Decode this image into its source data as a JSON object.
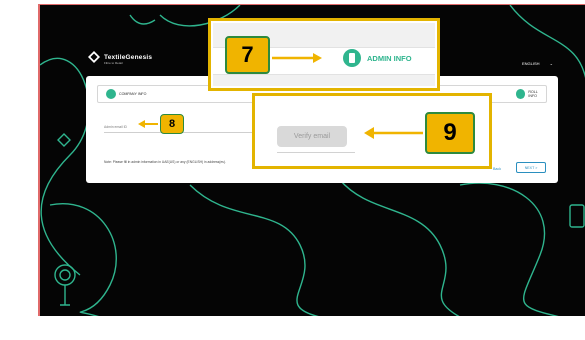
{
  "brand": {
    "name": "TextileGenesis",
    "tagline": "Fibre to Retail"
  },
  "header": {
    "language": "ENGLISH",
    "chevron": "⌄"
  },
  "stepper": {
    "company_info": "COMPANY INFO",
    "roll_info": "ROLL INFO",
    "admin_info": "ADMIN INFO"
  },
  "form": {
    "admin_email_placeholder": "Admin email ID",
    "verify_email_label": "Verify email",
    "note": "Note: Please fill in admin information in UAE(US) or any (ENGLISH) in address(es)."
  },
  "navigation": {
    "back_label": "Back",
    "next_label": "NEXT >"
  },
  "annotations": {
    "step_7": "7",
    "step_8": "8",
    "step_9": "9"
  },
  "colors": {
    "accent": "#2fb58e",
    "callout_border": "#e3b400",
    "badge_fill": "#f0b400",
    "badge_border": "#2e8a3e",
    "link": "#2a8fbf"
  },
  "icons": [
    "textilegenesis-logo-icon",
    "company-info-icon",
    "roll-info-icon",
    "admin-info-icon",
    "arrow-icon"
  ]
}
